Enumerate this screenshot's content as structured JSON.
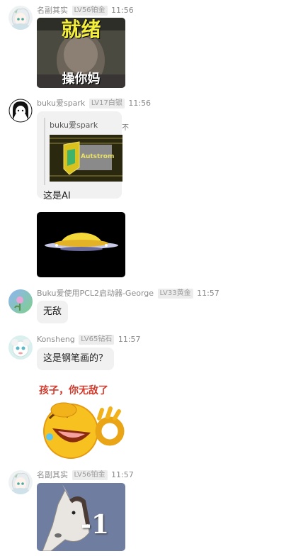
{
  "messages": [
    {
      "name": "名副其实",
      "level": "LV56",
      "rank": "铂金",
      "time": "11:56",
      "image_caption_top": "就绪",
      "image_caption_bottom": "操你妈"
    },
    {
      "name": "buku爱spark",
      "level": "LV17",
      "rank": "白银",
      "time": "11:56",
      "quote_name": "buku爱spark",
      "quote_more": "不",
      "quote_image_text": "Autstrom",
      "text": "这是AI"
    },
    {
      "name": "Buku爱使用PCL2启动器-George",
      "level": "LV33",
      "rank": "黄金",
      "time": "11:57",
      "text": "无敌"
    },
    {
      "name": "Konsheng",
      "level": "LV65",
      "rank": "钻石",
      "time": "11:57",
      "text": "这是钢笔画的？",
      "sticker_caption": "孩子，你无敌了"
    },
    {
      "name": "名副其实",
      "level": "LV56",
      "rank": "铂金",
      "time": "11:57",
      "sticker_caption": "-1"
    }
  ]
}
